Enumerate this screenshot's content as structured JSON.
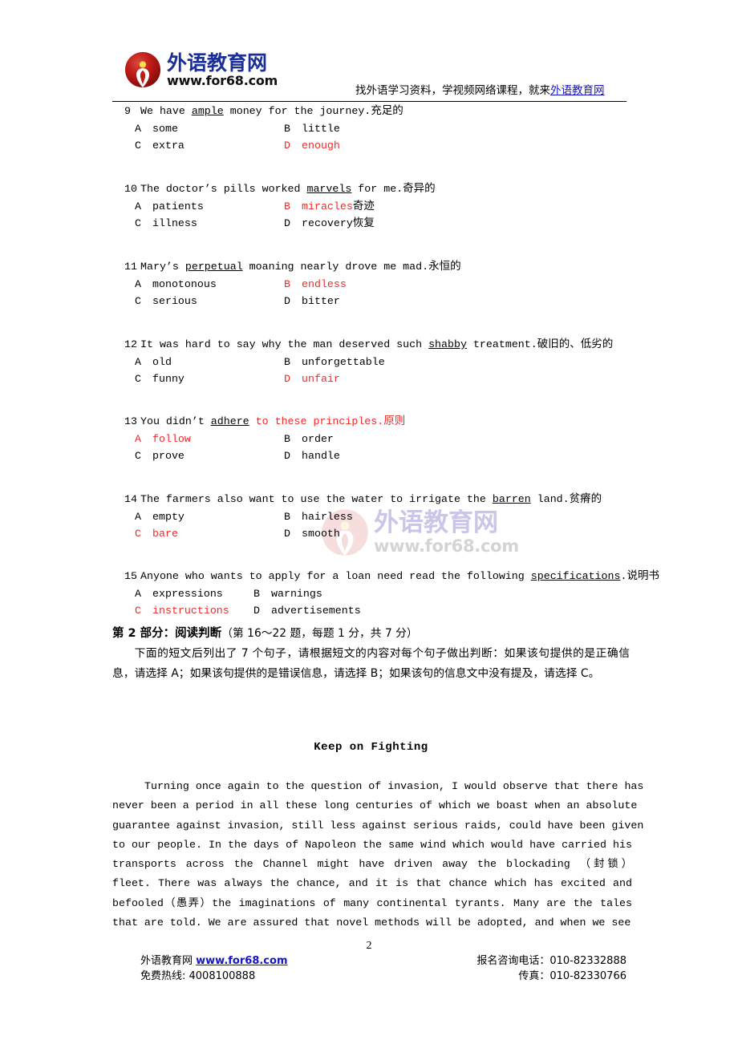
{
  "header": {
    "logo_cn": "外语教育网",
    "logo_url": "www.for68.com",
    "tagline_prefix": "找外语学习资料，学视频网络课程，就来",
    "tagline_link": "外语教育网",
    "logo_color": "#1a2f97",
    "link_color": "#1414c8"
  },
  "watermark": {
    "cn": "外语教育网",
    "url": "www.for68.com"
  },
  "answer_color": "#f12a2a",
  "questions": [
    {
      "num": "9",
      "stem_pre": "We have ",
      "stem_key": "ample",
      "stem_post": " money for the journey.",
      "stem_gloss": "充足的",
      "stem_red": false,
      "options": [
        {
          "letter": "A",
          "text": "some",
          "gloss": "",
          "correct": false
        },
        {
          "letter": "B",
          "text": "little",
          "gloss": "",
          "correct": false
        },
        {
          "letter": "C",
          "text": "extra",
          "gloss": "",
          "correct": false
        },
        {
          "letter": "D",
          "text": "enough",
          "gloss": "",
          "correct": true
        }
      ]
    },
    {
      "num": "10",
      "stem_pre": "The doctor’s pills worked ",
      "stem_key": "marvels",
      "stem_post": " for me.",
      "stem_gloss": "奇异的",
      "stem_red": false,
      "options": [
        {
          "letter": "A",
          "text": "patients",
          "gloss": "",
          "correct": false
        },
        {
          "letter": "B",
          "text": "miracles",
          "gloss": "奇迹",
          "correct": true
        },
        {
          "letter": "C",
          "text": "illness",
          "gloss": "",
          "correct": false
        },
        {
          "letter": "D",
          "text": "recovery",
          "gloss": "恢复",
          "correct": false
        }
      ]
    },
    {
      "num": "11",
      "stem_pre": "Mary’s ",
      "stem_key": "perpetual",
      "stem_post": " moaning nearly drove me mad.",
      "stem_gloss": "永恒的",
      "stem_red": false,
      "options": [
        {
          "letter": "A",
          "text": "monotonous",
          "gloss": "",
          "correct": false
        },
        {
          "letter": "B",
          "text": "endless",
          "gloss": "",
          "correct": true
        },
        {
          "letter": "C",
          "text": "serious",
          "gloss": "",
          "correct": false
        },
        {
          "letter": "D",
          "text": "bitter",
          "gloss": "",
          "correct": false
        }
      ]
    },
    {
      "num": "12",
      "stem_pre": "It was hard to say why the man deserved such ",
      "stem_key": "shabby",
      "stem_post": " treatment.",
      "stem_gloss": "破旧的、低劣的",
      "stem_red": false,
      "options": [
        {
          "letter": "A",
          "text": "old",
          "gloss": "",
          "correct": false
        },
        {
          "letter": "B",
          "text": "unforgettable",
          "gloss": "",
          "correct": false
        },
        {
          "letter": "C",
          "text": "funny",
          "gloss": "",
          "correct": false
        },
        {
          "letter": "D",
          "text": "unfair",
          "gloss": "",
          "correct": true
        }
      ]
    },
    {
      "num": "13",
      "stem_pre": "You didn’t ",
      "stem_key": "adhere",
      "stem_post": " to these principles.",
      "stem_gloss": "原则",
      "stem_red": true,
      "options": [
        {
          "letter": "A",
          "text": "follow",
          "gloss": "",
          "correct": true
        },
        {
          "letter": "B",
          "text": "order",
          "gloss": "",
          "correct": false
        },
        {
          "letter": "C",
          "text": "prove",
          "gloss": "",
          "correct": false
        },
        {
          "letter": "D",
          "text": "handle",
          "gloss": "",
          "correct": false
        }
      ]
    },
    {
      "num": "14",
      "stem_pre": "The farmers also want to use the water to irrigate the ",
      "stem_key": "barren",
      "stem_post": " land.",
      "stem_gloss": "贫瘠的",
      "stem_red": false,
      "options": [
        {
          "letter": "A",
          "text": "empty",
          "gloss": "",
          "correct": false
        },
        {
          "letter": "B",
          "text": "hairless",
          "gloss": "",
          "correct": false
        },
        {
          "letter": "C",
          "text": "bare",
          "gloss": "",
          "correct": true
        },
        {
          "letter": "D",
          "text": "smooth",
          "gloss": "",
          "correct": false
        }
      ]
    },
    {
      "num": "15",
      "stem_pre": "Anyone who wants to apply for a loan need read the following ",
      "stem_key": "specifications",
      "stem_post": ".",
      "stem_gloss": "说明书",
      "stem_red": false,
      "options": [
        {
          "letter": "A",
          "text": "expressions",
          "gloss": "",
          "correct": false
        },
        {
          "letter": "B",
          "text": "warnings",
          "gloss": "",
          "correct": false
        },
        {
          "letter": "C",
          "text": "instructions",
          "gloss": "",
          "correct": true
        },
        {
          "letter": "D",
          "text": "advertisements",
          "gloss": "",
          "correct": false
        }
      ]
    }
  ],
  "section": {
    "title": "第 2 部分：阅读判断",
    "subtitle": "（第 16～22 题，每题 1 分，共 7 分）",
    "instructions": "下面的短文后列出了 7 个句子，请根据短文的内容对每个句子做出判断：如果该句提供的是正确信息，请选择 A；如果该句提供的是错误信息，请选择 B；如果该句的信息文中没有提及，请选择 C。"
  },
  "passage": {
    "title": "Keep on Fighting",
    "lines": [
      "Turning once again to the question of invasion, I would observe that there has",
      "never been a period in all these long centuries of which we boast when an absolute",
      "guarantee against invasion, still less against serious raids, could have been given",
      "to our people. In the days of Napoleon the same wind which would have carried his",
      "transports across the Channel might have driven away the blockading （封锁）",
      "fleet. There was always the chance, and it is that chance which has excited and",
      "befooled（愚弄）the imaginations of many continental tyrants. Many are the tales",
      "that are told. We are assured that novel methods will be adopted, and when we see"
    ]
  },
  "footer": {
    "page_number": "2",
    "left_line1_prefix": "外语教育网 ",
    "left_line1_link": "www.for68.com",
    "left_line2": "免费热线: 4008100888",
    "right_line1": "报名咨询电话：010-82332888",
    "right_line2": "传真：010-82330766"
  }
}
